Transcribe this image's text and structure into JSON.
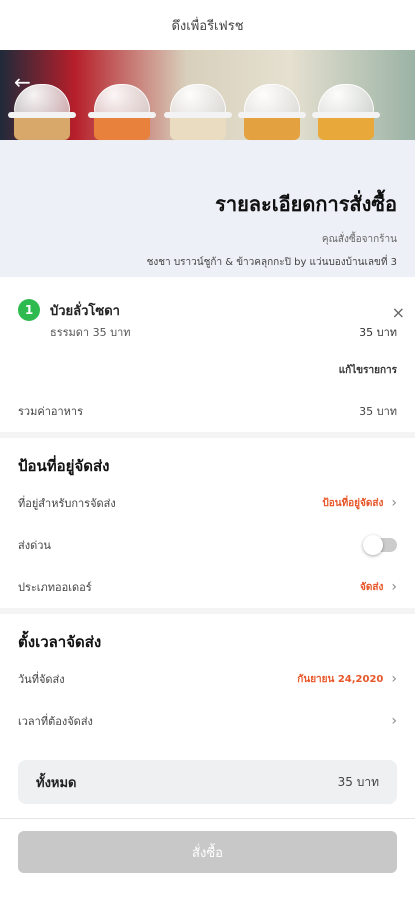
{
  "header": {
    "title": "ดึงเพื่อรีเฟรช"
  },
  "hero": {
    "back_icon": "arrow-left-icon"
  },
  "summary": {
    "title": "รายละเอียดการสั่งซื้อ",
    "ordered_from_label": "คุณสั่งซื้อจากร้าน",
    "store_name": "ชงชา บราวน์ชูก้า & ข้าวคลุกกะปิ by แว่นบองบ้านเลขที่ 3"
  },
  "item": {
    "qty": "1",
    "name": "บัวยลั่วโซดา",
    "option": "ธรรมดา 35 บาท",
    "price": "35 บาท",
    "edit_label": "แก้ไขรายการ"
  },
  "food_total": {
    "label": "รวมค่าอาหาร",
    "value": "35 บาท"
  },
  "address_section": {
    "title": "ป้อนที่อยู่จัดส่ง",
    "address_label": "ที่อยู่สำหรับการจัดส่ง",
    "address_value": "ป้อนที่อยู่จัดส่ง",
    "express_label": "ส่งด่วน",
    "order_type_label": "ประเภทออเดอร์",
    "order_type_value": "จัดส่ง"
  },
  "schedule_section": {
    "title": "ตั้งเวลาจัดส่ง",
    "date_label": "วันที่จัดส่ง",
    "date_value": "กันยายน 24,2020",
    "time_label": "เวลาที่ต้องจัดส่ง"
  },
  "total": {
    "label": "ทั้งหมด",
    "value": "35 บาท"
  },
  "footer": {
    "order_button": "สั่งซื้อ"
  },
  "colors": {
    "accent": "#e8572a",
    "badge": "#2fba4f"
  }
}
